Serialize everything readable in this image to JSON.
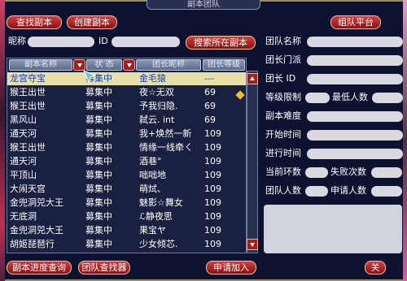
{
  "window": {
    "title": "副本团队"
  },
  "top_buttons": {
    "search_instance": "查找副本",
    "create_instance": "创建副本",
    "team_platform": "组队平台"
  },
  "search": {
    "nickname_label": "昵称",
    "id_label": "ID",
    "search_button": "搜索所在副本"
  },
  "table": {
    "headers": {
      "name": "副本名称",
      "status": "状 态",
      "leader": "团长昵称",
      "level": "团长等级"
    },
    "rows": [
      {
        "name": "龙宫夺宝",
        "status": "募集中",
        "leader": "金毛猿",
        "level": "---"
      },
      {
        "name": "猴王出世",
        "status": "募集中",
        "leader": "夜☆无双",
        "level": "69"
      },
      {
        "name": "猴王出世",
        "status": "募集中",
        "leader": "予我归隐.",
        "level": "69"
      },
      {
        "name": "黑风山",
        "status": "募集中",
        "leader": "弑云. int",
        "level": "69"
      },
      {
        "name": "通天河",
        "status": "募集中",
        "leader": "我+焕然一新",
        "level": "109"
      },
      {
        "name": "猴王出世",
        "status": "募集中",
        "leader": "情缘一线牵ㄑ",
        "level": "109"
      },
      {
        "name": "通天河",
        "status": "募集中",
        "leader": "酒巷°",
        "level": "109"
      },
      {
        "name": "平顶山",
        "status": "募集中",
        "leader": "咄咄地",
        "level": "109"
      },
      {
        "name": "大闹天宫",
        "status": "募集中",
        "leader": "萌烒、",
        "level": "109"
      },
      {
        "name": "金兜洞兕大王",
        "status": "募集中",
        "leader": "魅影☆舞女",
        "level": "109"
      },
      {
        "name": "无底洞",
        "status": "募集中",
        "leader": "ℒ静夜思",
        "level": "109"
      },
      {
        "name": "金兜洞兕大王",
        "status": "募集中",
        "leader": "果宝ヤ",
        "level": "109"
      },
      {
        "name": "胡姬琵琶行",
        "status": "募集中",
        "leader": "少女倾芯.",
        "level": "109"
      }
    ]
  },
  "details": {
    "team_name": "团队名称",
    "leader_sect": "团长门派",
    "leader_id": "团长 ID",
    "level_limit": "等级限制",
    "min_members": "最低人数",
    "difficulty": "副本难度",
    "start_time": "开始时间",
    "elapsed_time": "进行时间",
    "current_round": "当前环数",
    "failures": "失败次数",
    "team_size": "团队人数",
    "applicants": "申请人数"
  },
  "bottom_buttons": {
    "progress_query": "副本进度查询",
    "team_finder": "团队查找器",
    "apply_join": "申请加入",
    "close": "关"
  }
}
